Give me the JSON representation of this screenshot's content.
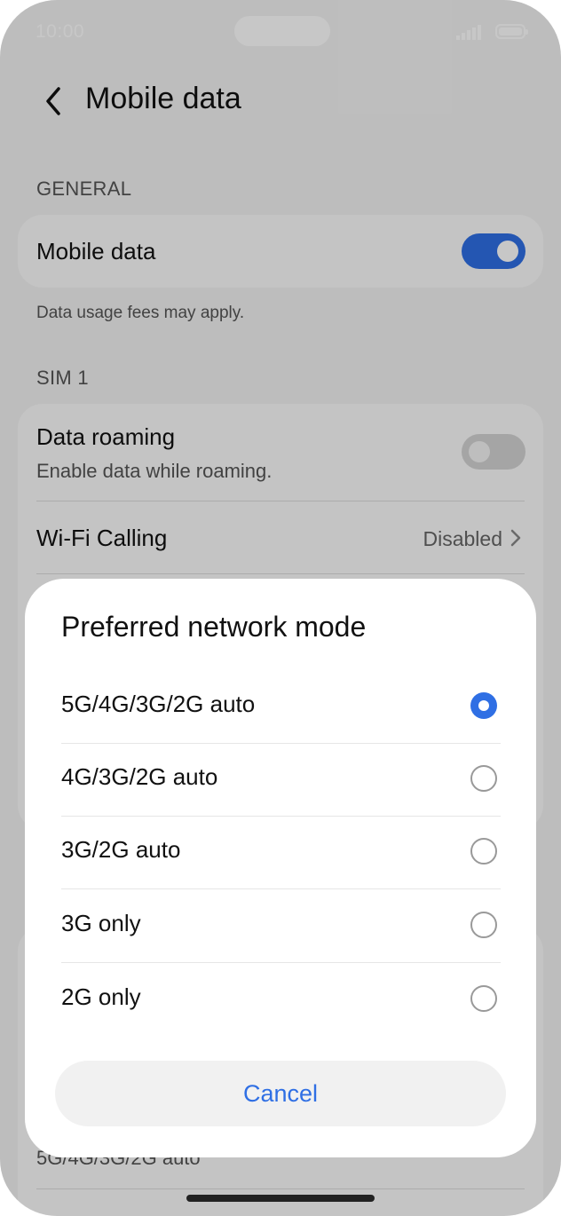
{
  "status_bar": {
    "time": "10:00"
  },
  "header": {
    "title": "Mobile data"
  },
  "general": {
    "section_label": "GENERAL",
    "mobile_data": {
      "label": "Mobile data",
      "toggle_on": true
    },
    "note": "Data usage fees may apply."
  },
  "sim1": {
    "section_label": "SIM 1",
    "data_roaming": {
      "label": "Data roaming",
      "subtitle": "Enable data while roaming.",
      "toggle_on": false
    },
    "wifi_calling": {
      "label": "Wi-Fi Calling",
      "value": "Disabled"
    }
  },
  "background_partial": {
    "network_mode_value": "5G/4G/3G/2G auto"
  },
  "dialog": {
    "title": "Preferred network mode",
    "options": [
      {
        "label": "5G/4G/3G/2G auto",
        "selected": true
      },
      {
        "label": "4G/3G/2G auto",
        "selected": false
      },
      {
        "label": "3G/2G auto",
        "selected": false
      },
      {
        "label": "3G only",
        "selected": false
      },
      {
        "label": "2G only",
        "selected": false
      }
    ],
    "cancel_label": "Cancel"
  },
  "colors": {
    "accent": "#2f6fe4",
    "toggle_on": "#2f6fe4",
    "toggle_off": "#d4d4d4",
    "scrim": "rgba(0,0,0,0.22)"
  }
}
